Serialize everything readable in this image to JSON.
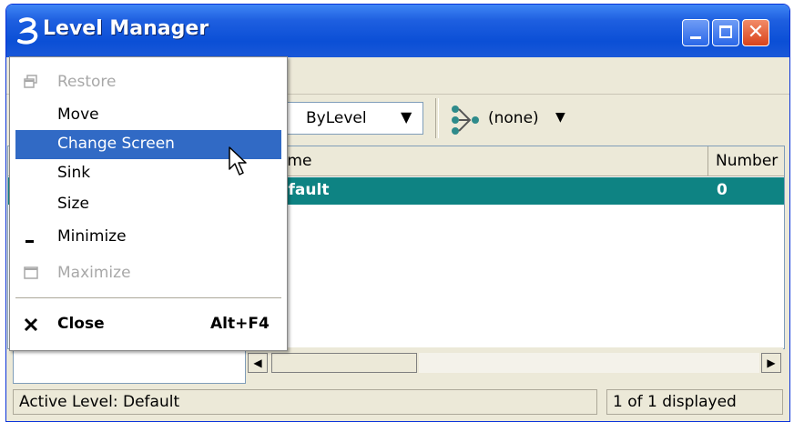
{
  "window": {
    "title": "Level Manager",
    "icons": {
      "app": "microstation-b-icon",
      "minimize": "minimize-icon",
      "maximize": "maximize-icon",
      "close": "close-x-icon"
    }
  },
  "toolbar": {
    "level_symbology_value": "ByLevel",
    "filter_value": "(none)"
  },
  "level_list": {
    "columns": [
      "ame",
      "Number"
    ],
    "rows": [
      {
        "name": "efault",
        "number": "0",
        "selected": true
      }
    ]
  },
  "system_menu": {
    "items": [
      {
        "label": "Restore",
        "enabled": false,
        "icon": "restore-icon"
      },
      {
        "label": "Move",
        "enabled": true
      },
      {
        "label": "Change Screen",
        "enabled": true,
        "selected": true
      },
      {
        "label": "Sink",
        "enabled": true
      },
      {
        "label": "Size",
        "enabled": true
      },
      {
        "label": "Minimize",
        "enabled": true,
        "icon": "minimize-icon"
      },
      {
        "label": "Maximize",
        "enabled": false,
        "icon": "maximize-icon"
      },
      {
        "label": "Close",
        "enabled": true,
        "bold": true,
        "icon": "close-x-icon",
        "accelerator": "Alt+F4"
      }
    ]
  },
  "status_bar": {
    "active_level": "Active Level: Default",
    "count": "1 of 1 displayed"
  },
  "colors": {
    "titlebar": "#0b4fd6",
    "selection": "#316ac5",
    "row_highlight": "#0e8383",
    "window_bg": "#ece9d8"
  }
}
